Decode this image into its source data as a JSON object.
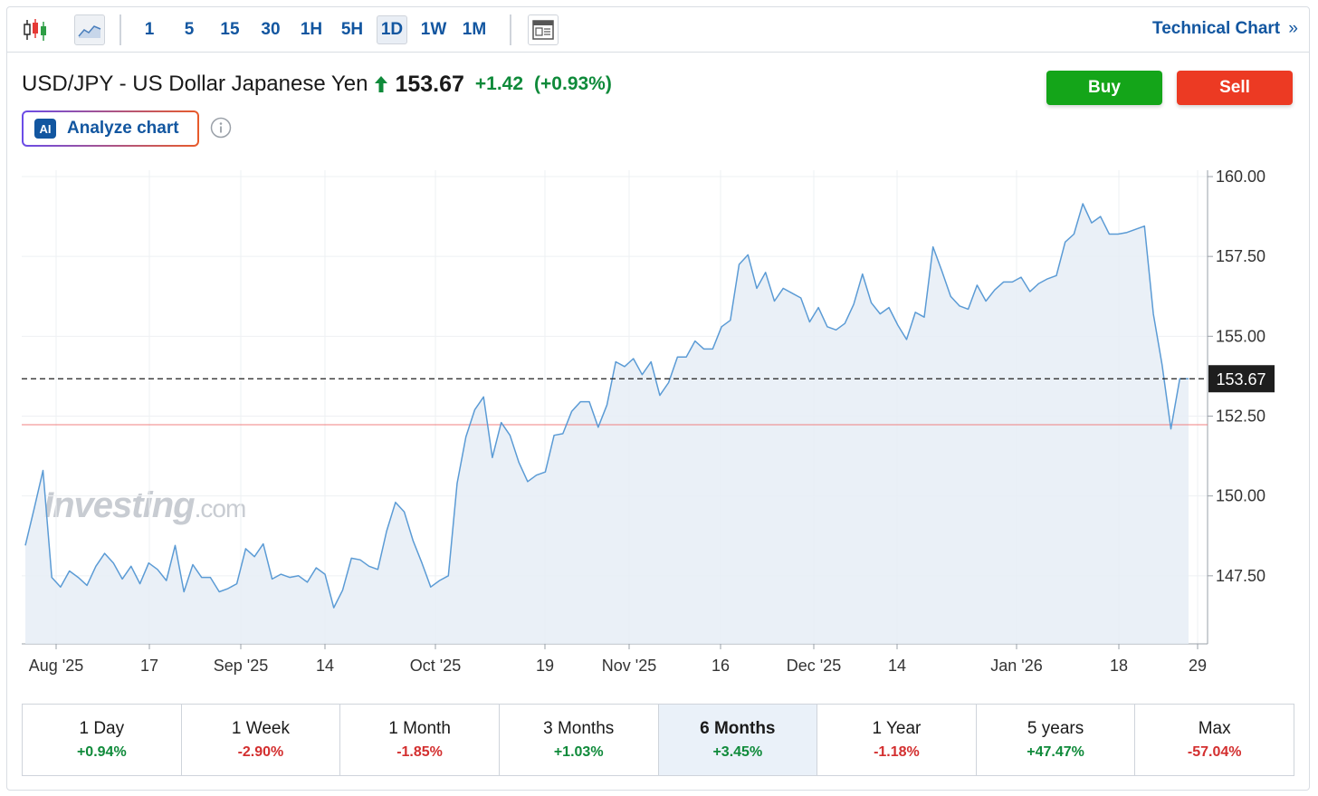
{
  "toolbar": {
    "timeframes": [
      "1",
      "5",
      "15",
      "30",
      "1H",
      "5H",
      "1D",
      "1W",
      "1M"
    ],
    "active_timeframe": "1D",
    "technical_link": "Technical Chart",
    "icons": [
      "candlestick-icon",
      "area-chart-icon",
      "news-layout-icon",
      "double-chevron-right-icon"
    ]
  },
  "header": {
    "instrument": "USD/JPY - US Dollar Japanese Yen",
    "last_price": "153.67",
    "change": "+1.42",
    "change_pct": "(+0.93%)",
    "direction": "up"
  },
  "actions": {
    "buy": "Buy",
    "sell": "Sell"
  },
  "analyze": {
    "badge": "AI",
    "label": "Analyze chart"
  },
  "watermark": {
    "brand": "Investing",
    "suffix": ".com"
  },
  "chart_data": {
    "type": "area",
    "ylim": [
      145.0,
      160.0
    ],
    "y_ticks": [
      "160.00",
      "157.50",
      "155.00",
      "152.50",
      "150.00",
      "147.50"
    ],
    "x_ticks": [
      "Aug '25",
      "17",
      "Sep '25",
      "14",
      "Oct '25",
      "19",
      "Nov '25",
      "16",
      "Dec '25",
      "14",
      "Jan '26",
      "18",
      "29"
    ],
    "current_price_label": "153.67",
    "previous_close_line": 152.23,
    "colors": {
      "line": "#5b9bd5",
      "fill": "#e6edf6",
      "prev_close": "#f08080",
      "price_tag": "#1e1e1e"
    },
    "series": [
      {
        "values": [
          148.45,
          149.6,
          150.8,
          147.45,
          147.15,
          147.65,
          147.45,
          147.2,
          147.8,
          148.2,
          147.9,
          147.4,
          147.8,
          147.25,
          147.9,
          147.7,
          147.35,
          148.45,
          147.0,
          147.85,
          147.45,
          147.45,
          147.0,
          147.1,
          147.25,
          148.35,
          148.1,
          148.5,
          147.4,
          147.55,
          147.45,
          147.5,
          147.3,
          147.75,
          147.55,
          146.5,
          147.05,
          148.05,
          148.0,
          147.8,
          147.7,
          148.9,
          149.8,
          149.5,
          148.6,
          147.9,
          147.15,
          147.35,
          147.5,
          150.4,
          151.85,
          152.7,
          153.1,
          151.2,
          152.3,
          151.9,
          151.05,
          150.45,
          150.65,
          150.75,
          151.9,
          151.95,
          152.65,
          152.95,
          152.95,
          152.15,
          152.85,
          154.2,
          154.05,
          154.3,
          153.8,
          154.2,
          153.15,
          153.55,
          154.35,
          154.35,
          154.85,
          154.6,
          154.6,
          155.3,
          155.5,
          157.25,
          157.55,
          156.5,
          157.0,
          156.1,
          156.5,
          156.35,
          156.2,
          155.45,
          155.9,
          155.3,
          155.2,
          155.4,
          156.0,
          156.95,
          156.05,
          155.7,
          155.9,
          155.35,
          154.9,
          155.75,
          155.6,
          157.8,
          157.05,
          156.25,
          155.95,
          155.85,
          156.6,
          156.1,
          156.45,
          156.7,
          156.7,
          156.85,
          156.4,
          156.65,
          156.8,
          156.9,
          157.95,
          158.2,
          159.15,
          158.55,
          158.75,
          158.2,
          158.2,
          158.25,
          158.35,
          158.45,
          155.7,
          154.1,
          152.1,
          153.67,
          153.67
        ]
      }
    ]
  },
  "periods": [
    {
      "label": "1 Day",
      "value": "+0.94%",
      "dir": "up"
    },
    {
      "label": "1 Week",
      "value": "-2.90%",
      "dir": "down"
    },
    {
      "label": "1 Month",
      "value": "-1.85%",
      "dir": "down"
    },
    {
      "label": "3 Months",
      "value": "+1.03%",
      "dir": "up"
    },
    {
      "label": "6 Months",
      "value": "+3.45%",
      "dir": "up",
      "active": true
    },
    {
      "label": "1 Year",
      "value": "-1.18%",
      "dir": "down"
    },
    {
      "label": "5 years",
      "value": "+47.47%",
      "dir": "up"
    },
    {
      "label": "Max",
      "value": "-57.04%",
      "dir": "down"
    }
  ]
}
